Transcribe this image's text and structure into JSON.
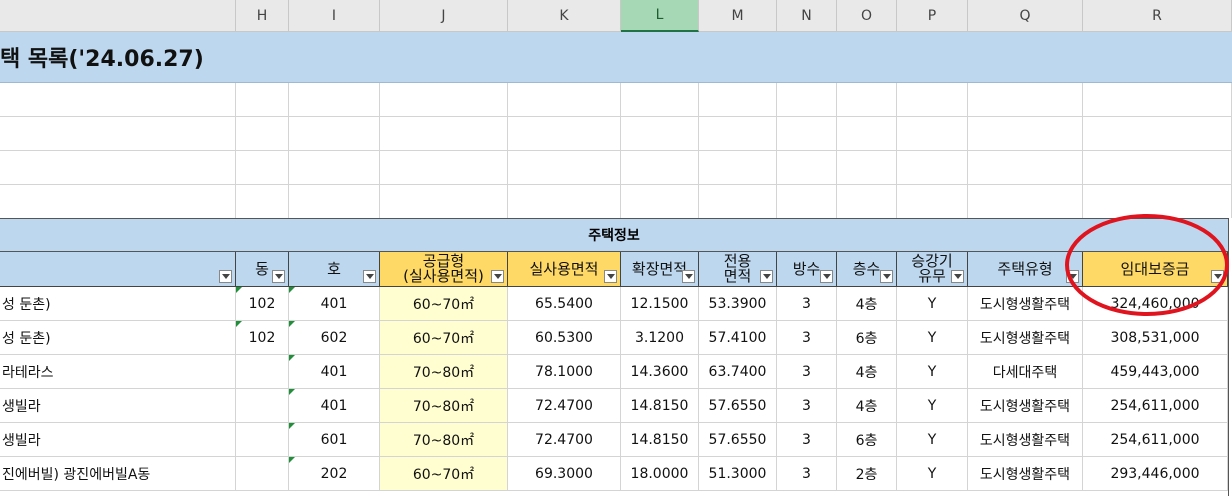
{
  "columns": [
    "H",
    "I",
    "J",
    "K",
    "L",
    "M",
    "N",
    "O",
    "P",
    "Q",
    "R"
  ],
  "selected_column": "L",
  "title": "택 목록('24.06.27)",
  "group_header": "주택정보",
  "headers": {
    "name": "",
    "dong": "동",
    "ho": "호",
    "supply_type_1": "공급형",
    "supply_type_2": "(실사용면적)",
    "actual_area": "실사용면적",
    "ext_area": "확장면적",
    "excl_area_1": "전용",
    "excl_area_2": "면적",
    "rooms": "방수",
    "floor": "층수",
    "elevator_1": "승강기",
    "elevator_2": "유무",
    "house_type": "주택유형",
    "deposit": "임대보증금"
  },
  "rows": [
    {
      "name": "성 둔촌)",
      "dong": "102",
      "ho": "401",
      "supply": "60~70㎡",
      "actual": "65.5400",
      "ext": "12.1500",
      "excl": "53.3900",
      "rooms": "3",
      "floor": "4층",
      "elev": "Y",
      "type": "도시형생활주택",
      "deposit": "324,460,000"
    },
    {
      "name": "성 둔촌)",
      "dong": "102",
      "ho": "602",
      "supply": "60~70㎡",
      "actual": "60.5300",
      "ext": "3.1200",
      "excl": "57.4100",
      "rooms": "3",
      "floor": "6층",
      "elev": "Y",
      "type": "도시형생활주택",
      "deposit": "308,531,000"
    },
    {
      "name": "라테라스",
      "dong": "",
      "ho": "401",
      "supply": "70~80㎡",
      "actual": "78.1000",
      "ext": "14.3600",
      "excl": "63.7400",
      "rooms": "3",
      "floor": "4층",
      "elev": "Y",
      "type": "다세대주택",
      "deposit": "459,443,000"
    },
    {
      "name": "생빌라",
      "dong": "",
      "ho": "401",
      "supply": "70~80㎡",
      "actual": "72.4700",
      "ext": "14.8150",
      "excl": "57.6550",
      "rooms": "3",
      "floor": "4층",
      "elev": "Y",
      "type": "도시형생활주택",
      "deposit": "254,611,000"
    },
    {
      "name": "생빌라",
      "dong": "",
      "ho": "601",
      "supply": "70~80㎡",
      "actual": "72.4700",
      "ext": "14.8150",
      "excl": "57.6550",
      "rooms": "3",
      "floor": "6층",
      "elev": "Y",
      "type": "도시형생활주택",
      "deposit": "254,611,000"
    },
    {
      "name": "진에버빌) 광진에버빌A동",
      "dong": "",
      "ho": "202",
      "supply": "60~70㎡",
      "actual": "69.3000",
      "ext": "18.0000",
      "excl": "51.3000",
      "rooms": "3",
      "floor": "2층",
      "elev": "Y",
      "type": "도시형생활주택",
      "deposit": "293,446,000"
    }
  ],
  "annotation_color": "#e0141e"
}
